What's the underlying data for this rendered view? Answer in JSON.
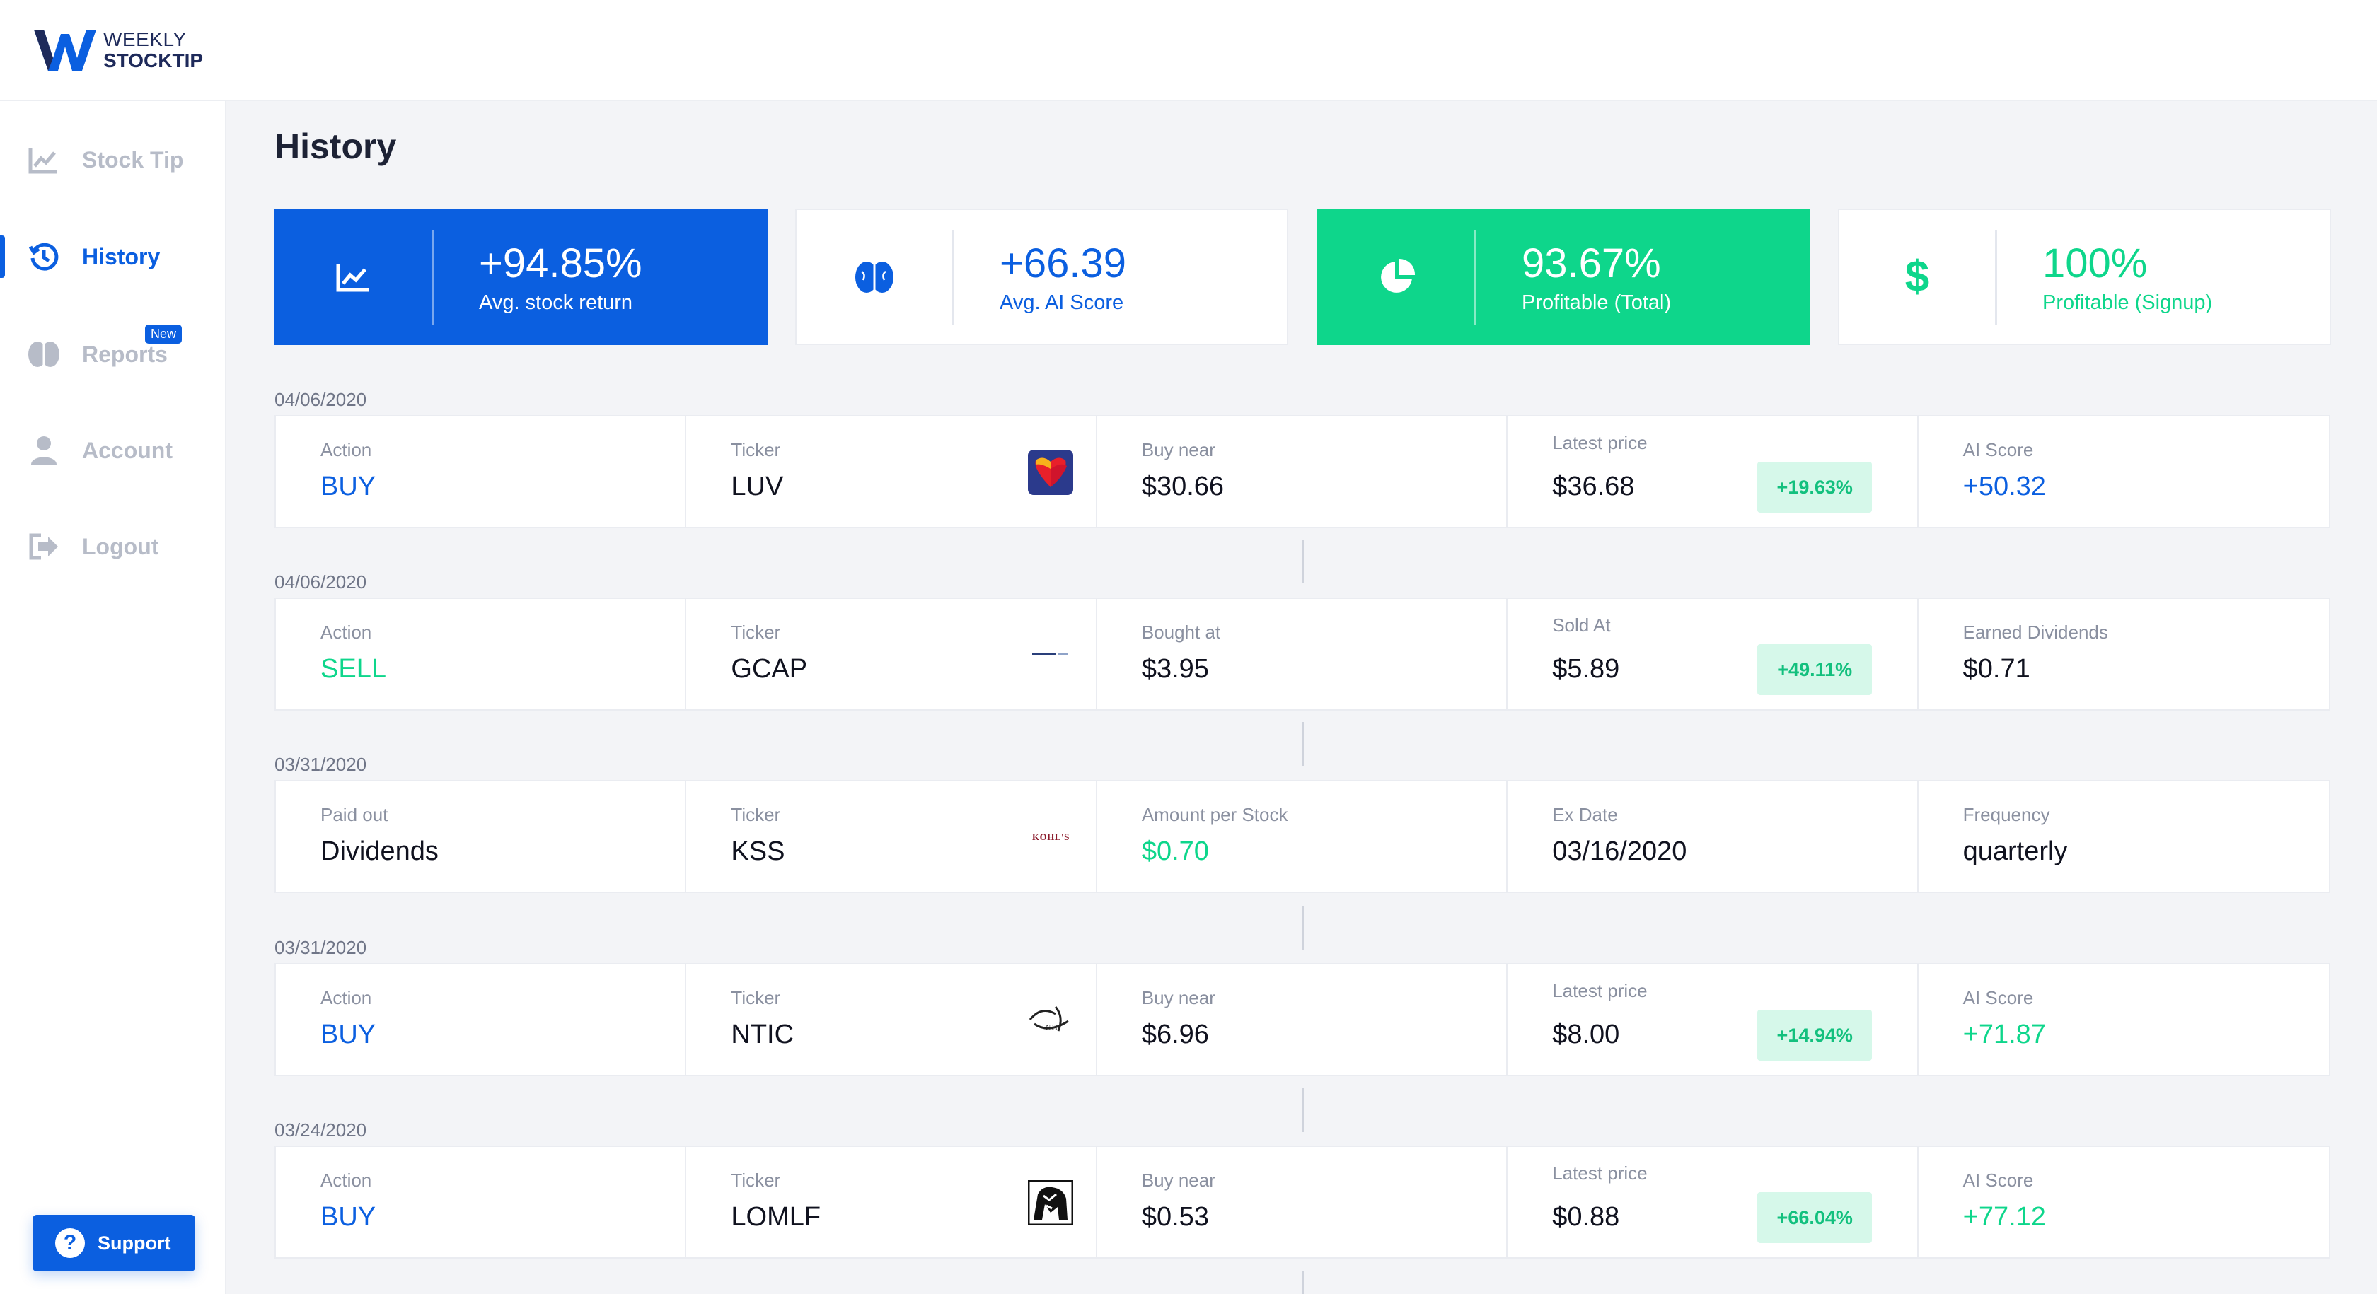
{
  "brand": {
    "line1": "WEEKLY",
    "line2": "STOCKTIP"
  },
  "nav": [
    {
      "label": "Stock Tip",
      "icon": "chart-line-icon",
      "active": false
    },
    {
      "label": "History",
      "icon": "history-icon",
      "active": true
    },
    {
      "label": "Reports",
      "icon": "brain-icon",
      "active": false,
      "badge": "New"
    },
    {
      "label": "Account",
      "icon": "user-icon",
      "active": false
    },
    {
      "label": "Logout",
      "icon": "logout-icon",
      "active": false
    }
  ],
  "support": {
    "label": "Support",
    "glyph": "?"
  },
  "page": {
    "title": "History"
  },
  "stats": [
    {
      "value": "+94.85%",
      "label": "Avg. stock return",
      "icon": "chart-line-icon"
    },
    {
      "value": "+66.39",
      "label": "Avg. AI Score",
      "icon": "brain-icon"
    },
    {
      "value": "93.67%",
      "label": "Profitable (Total)",
      "icon": "pie-chart-icon"
    },
    {
      "value": "100%",
      "label": "Profitable (Signup)",
      "icon": "dollar-icon",
      "glyph": "$"
    }
  ],
  "entries": [
    {
      "date": "04/06/2020",
      "cells": [
        {
          "label": "Action",
          "value": "BUY"
        },
        {
          "label": "Ticker",
          "value": "LUV",
          "logo": "southwest-logo"
        },
        {
          "label": "Buy near",
          "value": "$30.66"
        },
        {
          "label": "Latest price",
          "value": "$36.68",
          "change": "+19.63%"
        },
        {
          "label": "AI Score",
          "value": "+50.32"
        }
      ]
    },
    {
      "date": "04/06/2020",
      "cells": [
        {
          "label": "Action",
          "value": "SELL"
        },
        {
          "label": "Ticker",
          "value": "GCAP",
          "logo": "gain-capital-logo"
        },
        {
          "label": "Bought at",
          "value": "$3.95"
        },
        {
          "label": "Sold At",
          "value": "$5.89",
          "change": "+49.11%"
        },
        {
          "label": "Earned Dividends",
          "value": "$0.71"
        }
      ]
    },
    {
      "date": "03/31/2020",
      "cells": [
        {
          "label": "Paid out",
          "value": "Dividends"
        },
        {
          "label": "Ticker",
          "value": "KSS",
          "logo": "kohls-logo",
          "logo_text": "KOHL'S"
        },
        {
          "label": "Amount per Stock",
          "value": "$0.70"
        },
        {
          "label": "Ex Date",
          "value": "03/16/2020"
        },
        {
          "label": "Frequency",
          "value": "quarterly"
        }
      ]
    },
    {
      "date": "03/31/2020",
      "cells": [
        {
          "label": "Action",
          "value": "BUY"
        },
        {
          "label": "Ticker",
          "value": "NTIC",
          "logo": "nti-logo",
          "logo_text": "NTI"
        },
        {
          "label": "Buy near",
          "value": "$6.96"
        },
        {
          "label": "Latest price",
          "value": "$8.00",
          "change": "+14.94%"
        },
        {
          "label": "AI Score",
          "value": "+71.87"
        }
      ]
    },
    {
      "date": "03/24/2020",
      "cells": [
        {
          "label": "Action",
          "value": "BUY"
        },
        {
          "label": "Ticker",
          "value": "LOMLF",
          "logo": "lion-logo"
        },
        {
          "label": "Buy near",
          "value": "$0.53"
        },
        {
          "label": "Latest price",
          "value": "$0.88",
          "change": "+66.04%"
        },
        {
          "label": "AI Score",
          "value": "+77.12"
        }
      ]
    }
  ],
  "colors": {
    "primary": "#0b5fe0",
    "green": "#0ed68b",
    "muted": "#b7bcc8"
  }
}
